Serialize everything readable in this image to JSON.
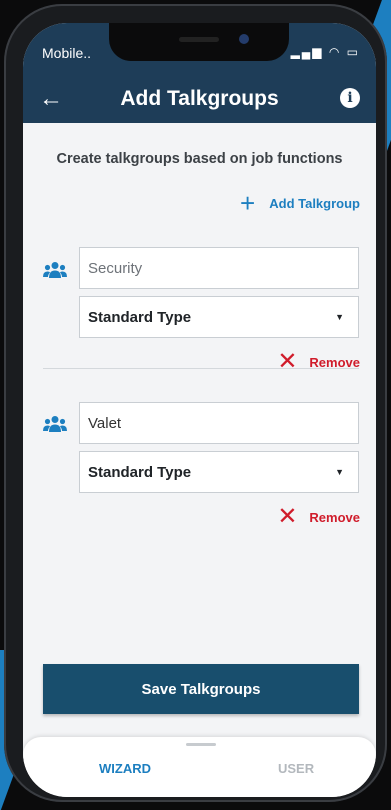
{
  "status": {
    "carrier": "Mobile..",
    "icons": "▂▄▆ ◠ ▭"
  },
  "header": {
    "title": "Add Talkgroups",
    "back_icon": "arrow-left-icon",
    "info_icon": "info-icon"
  },
  "main": {
    "subtitle": "Create talkgroups based on job functions",
    "add_talkgroup_label": "Add Talkgroup",
    "groups": [
      {
        "name_placeholder": "Security",
        "name_value": "",
        "type": "Standard Type",
        "remove_label": "Remove"
      },
      {
        "name_placeholder": "",
        "name_value": "Valet",
        "type": "Standard Type",
        "remove_label": "Remove"
      }
    ],
    "save_label": "Save Talkgroups"
  },
  "tabs": [
    {
      "label": "WIZARD",
      "active": true
    },
    {
      "label": "USER",
      "active": false
    }
  ],
  "colors": {
    "header": "#1e3d58",
    "accent": "#1d7fc0",
    "danger": "#d01c2b",
    "save": "#184e6d"
  }
}
